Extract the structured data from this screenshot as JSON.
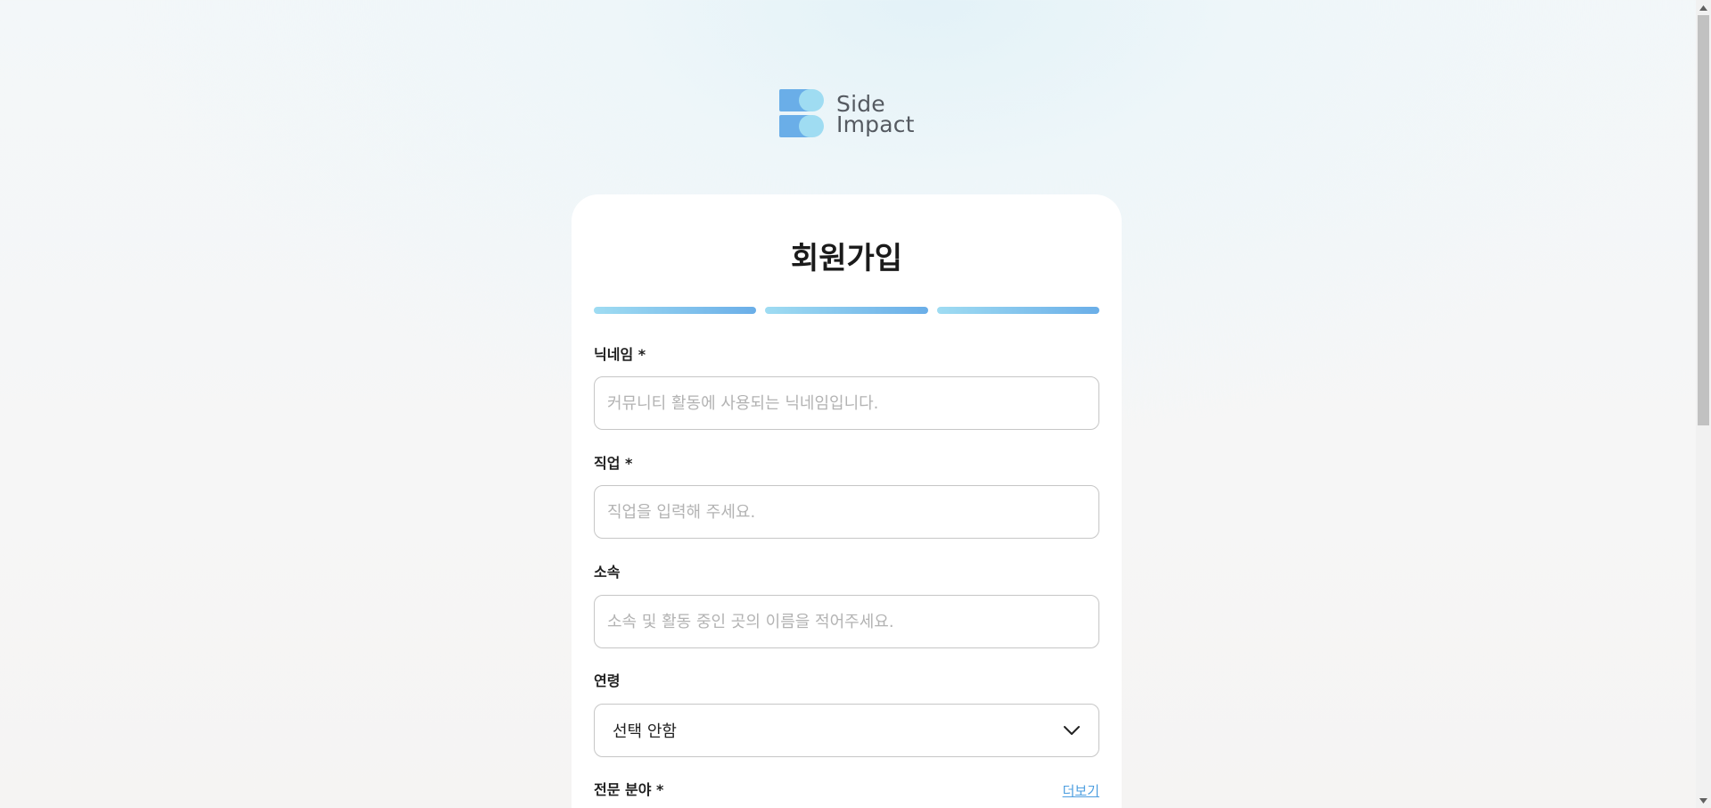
{
  "brand": {
    "line1": "Side",
    "line2": "Impact",
    "colors": {
      "primary": "#6aaee8",
      "secondary": "#9fdcf2"
    }
  },
  "form": {
    "title": "회원가입",
    "progress_steps": 3,
    "fields": {
      "nickname": {
        "label": "닉네임 *",
        "placeholder": "커뮤니티 활동에 사용되는 닉네임입니다.",
        "value": ""
      },
      "job": {
        "label": "직업 *",
        "placeholder": "직업을 입력해 주세요.",
        "value": ""
      },
      "affiliation": {
        "label": "소속",
        "placeholder": "소속 및 활동 중인 곳의 이름을 적어주세요.",
        "value": ""
      },
      "age": {
        "label": "연령",
        "selected": "선택 안함",
        "icon": "chevron-down-icon"
      },
      "expertise": {
        "label": "전문 분야 *",
        "more_link": "더보기"
      }
    }
  },
  "scrollbar": {
    "up_icon": "scroll-up-arrow-icon",
    "down_icon": "scroll-down-arrow-icon"
  }
}
